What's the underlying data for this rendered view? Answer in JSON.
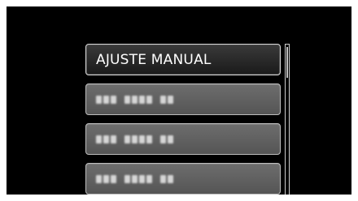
{
  "menu": {
    "items": [
      {
        "label": "AJUSTE MANUAL",
        "state": "selected"
      },
      {
        "label": "",
        "state": "blurred"
      },
      {
        "label": "",
        "state": "blurred"
      },
      {
        "label": "",
        "state": "blurred"
      }
    ]
  },
  "colors": {
    "screen_background": "#000000",
    "selected_item_background": "#2a2a2a",
    "dim_item_background": "#606060",
    "text": "#ffffff"
  }
}
